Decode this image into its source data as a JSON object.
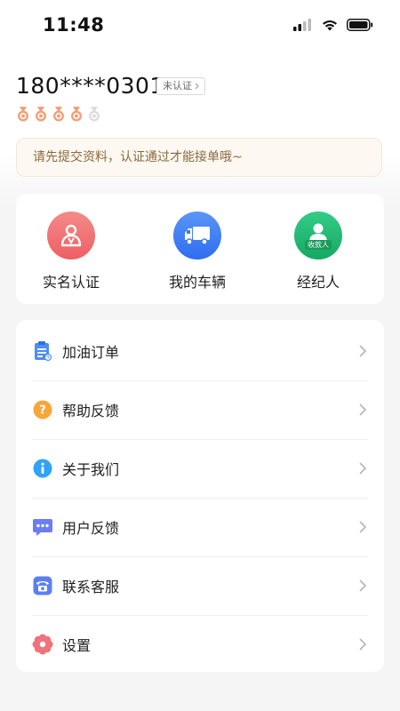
{
  "status_bar": {
    "time": "11:48"
  },
  "profile": {
    "phone": "180****0301",
    "verify_tag": "未认证",
    "medal_count": 4,
    "medal_total": 5
  },
  "notice": {
    "text": "请先提交资料，认证通过才能接单哦~"
  },
  "quick_actions": [
    {
      "label": "实名认证",
      "icon": "person-id-icon",
      "color": "#f2686a"
    },
    {
      "label": "我的车辆",
      "icon": "truck-icon",
      "color": "#3e7bf2"
    },
    {
      "label": "经纪人",
      "icon": "agent-icon",
      "color": "#21b872",
      "badge": "收款人"
    }
  ],
  "menu": [
    {
      "label": "加油订单",
      "icon": "fuel-order-icon",
      "color": "#4c8df6"
    },
    {
      "label": "帮助反馈",
      "icon": "help-icon",
      "color": "#f7a63a"
    },
    {
      "label": "关于我们",
      "icon": "info-icon",
      "color": "#2fa3f5"
    },
    {
      "label": "用户反馈",
      "icon": "chat-bubble-icon",
      "color": "#6b7cf5"
    },
    {
      "label": "联系客服",
      "icon": "telephone-icon",
      "color": "#5b7ff2"
    },
    {
      "label": "设置",
      "icon": "settings-flower-icon",
      "color": "#f0727a"
    }
  ],
  "colors": {
    "medal_active": "#f0a07a",
    "medal_inactive": "#dddddd",
    "notice_text": "#8a6a3e"
  }
}
